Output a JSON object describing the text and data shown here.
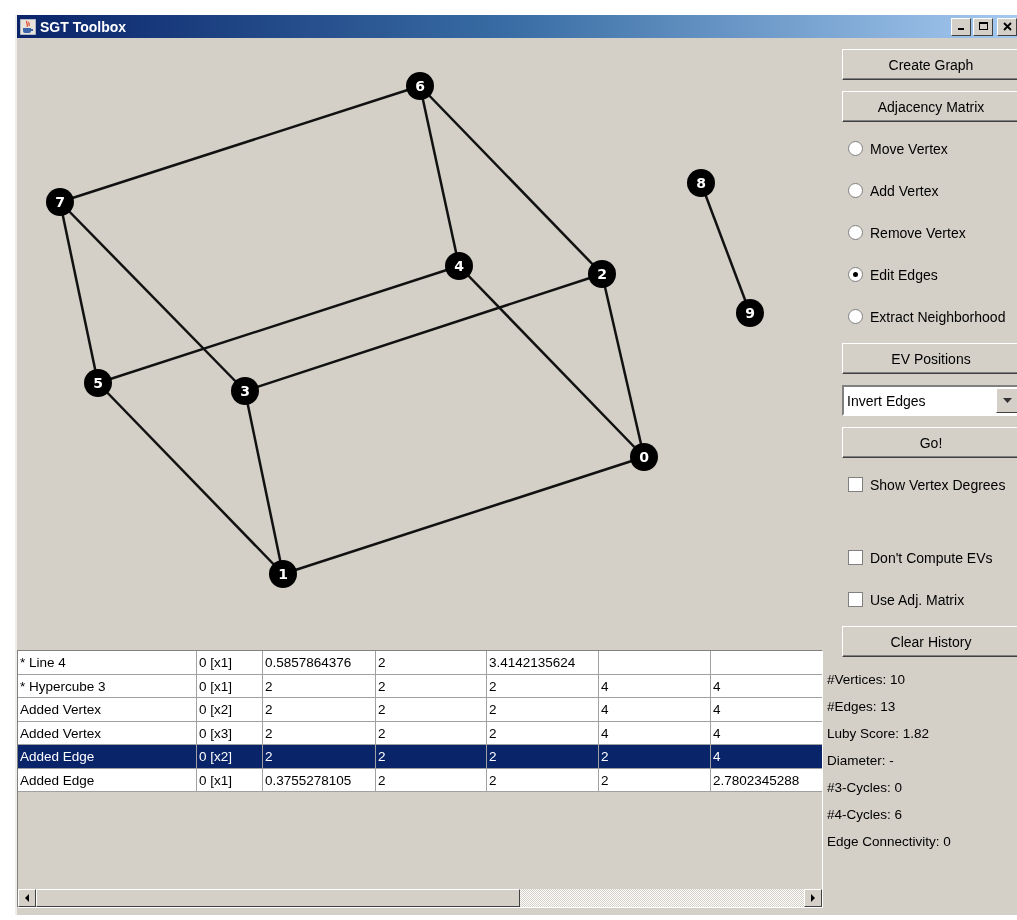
{
  "window": {
    "title": "SGT Toolbox"
  },
  "graph": {
    "vertices": [
      {
        "label": "0"
      },
      {
        "label": "1"
      },
      {
        "label": "2"
      },
      {
        "label": "3"
      },
      {
        "label": "4"
      },
      {
        "label": "5"
      },
      {
        "label": "6"
      },
      {
        "label": "7"
      },
      {
        "label": "8"
      },
      {
        "label": "9"
      }
    ]
  },
  "controls": [
    {
      "kind": "button",
      "label": "Create Graph"
    },
    {
      "kind": "button",
      "label": "Adjacency Matrix"
    },
    {
      "kind": "radio",
      "label": "Move Vertex",
      "selected": false
    },
    {
      "kind": "radio",
      "label": "Add Vertex",
      "selected": false
    },
    {
      "kind": "radio",
      "label": "Remove Vertex",
      "selected": false
    },
    {
      "kind": "radio",
      "label": "Edit Edges",
      "selected": true
    },
    {
      "kind": "radio",
      "label": "Extract Neighborhood",
      "selected": false
    },
    {
      "kind": "button",
      "label": "EV Positions"
    },
    {
      "kind": "dropdown",
      "value": "Invert Edges"
    },
    {
      "kind": "button",
      "label": "Go!"
    },
    {
      "kind": "checkbox",
      "label": "Show Vertex Degrees",
      "checked": false
    },
    {
      "kind": "spacer"
    },
    {
      "kind": "checkbox",
      "label": "Don't Compute EVs",
      "checked": false
    },
    {
      "kind": "checkbox",
      "label": "Use Adj. Matrix",
      "checked": false
    },
    {
      "kind": "button",
      "label": "Clear History"
    }
  ],
  "history_table": {
    "rows": [
      {
        "selected": false,
        "cells": [
          "* Line 4",
          "0 [x1]",
          "0.5857864376",
          "2",
          "3.4142135624",
          "",
          ""
        ]
      },
      {
        "selected": false,
        "cells": [
          "* Hypercube 3",
          "0 [x1]",
          "2",
          "2",
          "2",
          "4",
          "4"
        ]
      },
      {
        "selected": false,
        "cells": [
          "Added Vertex",
          "0 [x2]",
          "2",
          "2",
          "2",
          "4",
          "4"
        ]
      },
      {
        "selected": false,
        "cells": [
          "Added Vertex",
          "0 [x3]",
          "2",
          "2",
          "2",
          "4",
          "4"
        ]
      },
      {
        "selected": true,
        "cells": [
          "Added Edge",
          "0 [x2]",
          "2",
          "2",
          "2",
          "2",
          "4"
        ]
      },
      {
        "selected": false,
        "cells": [
          "Added Edge",
          "0 [x1]",
          "0.3755278105",
          "2",
          "2",
          "2",
          "2.7802345288"
        ]
      }
    ]
  },
  "stats": [
    "#Vertices: 10",
    "#Edges: 13",
    "Luby Score: 1.82",
    "Diameter: -",
    "#3-Cycles: 0",
    "#4-Cycles: 6",
    "Edge Connectivity: 0"
  ]
}
